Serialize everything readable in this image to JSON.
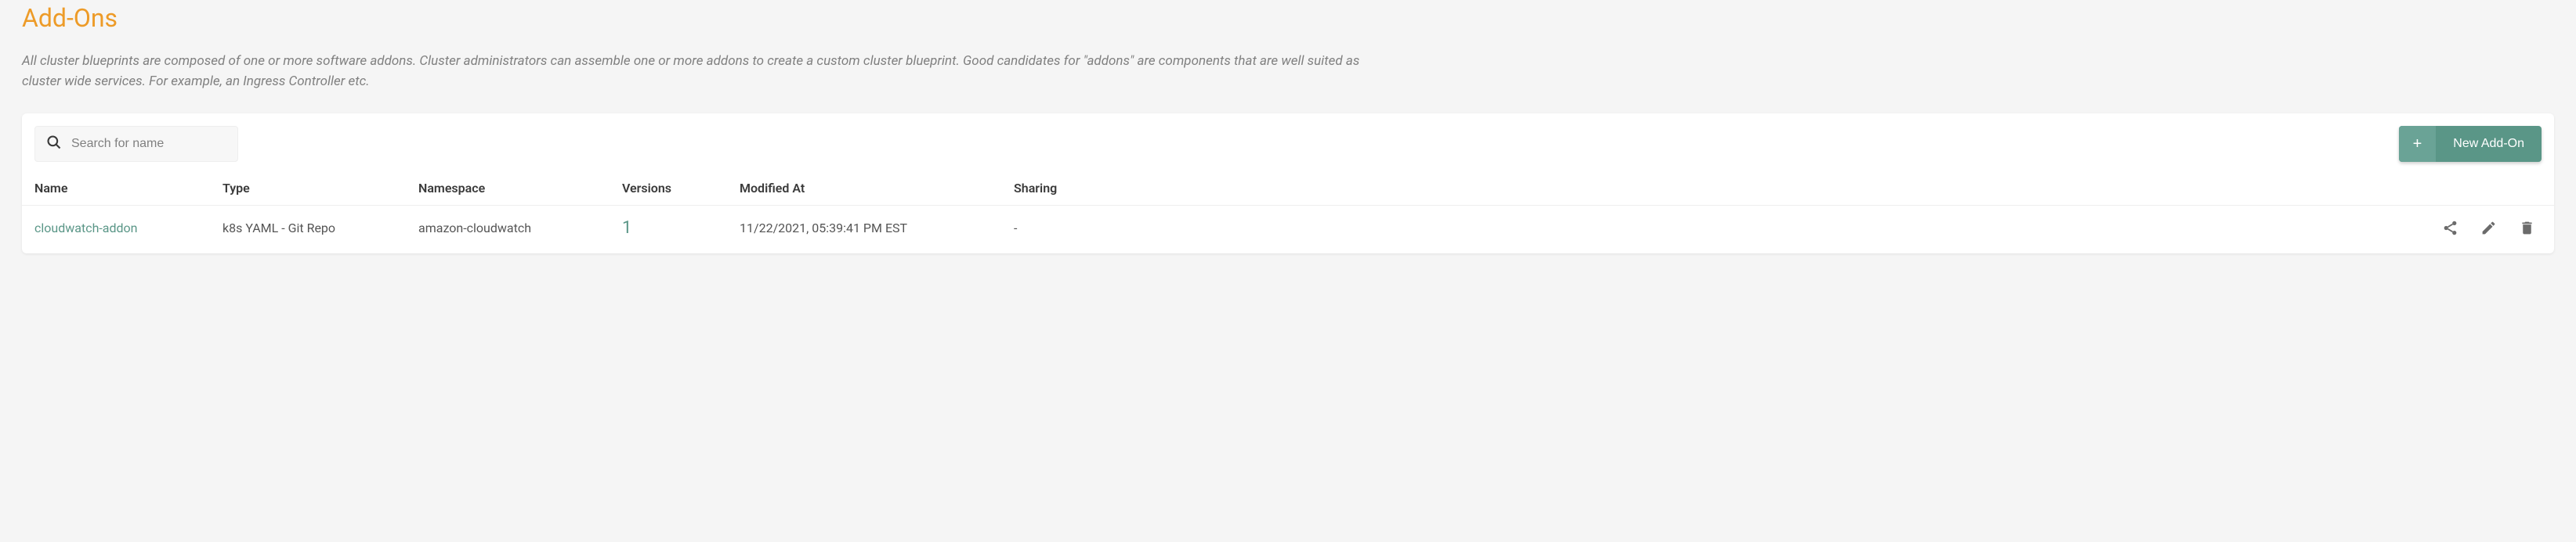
{
  "header": {
    "title": "Add-Ons",
    "description": "All cluster blueprints are composed of one or more software addons. Cluster administrators can assemble one or more addons to create a custom cluster blueprint. Good candidates for \"addons\" are components that are well suited as cluster wide services. For example, an Ingress Controller etc."
  },
  "toolbar": {
    "search_placeholder": "Search for name",
    "new_button_label": "New Add-On"
  },
  "table": {
    "columns": {
      "name": "Name",
      "type": "Type",
      "namespace": "Namespace",
      "versions": "Versions",
      "modified_at": "Modified At",
      "sharing": "Sharing"
    },
    "rows": [
      {
        "name": "cloudwatch-addon",
        "type": "k8s YAML - Git Repo",
        "namespace": "amazon-cloudwatch",
        "versions": "1",
        "modified_at": "11/22/2021, 05:39:41 PM EST",
        "sharing": "-"
      }
    ]
  }
}
